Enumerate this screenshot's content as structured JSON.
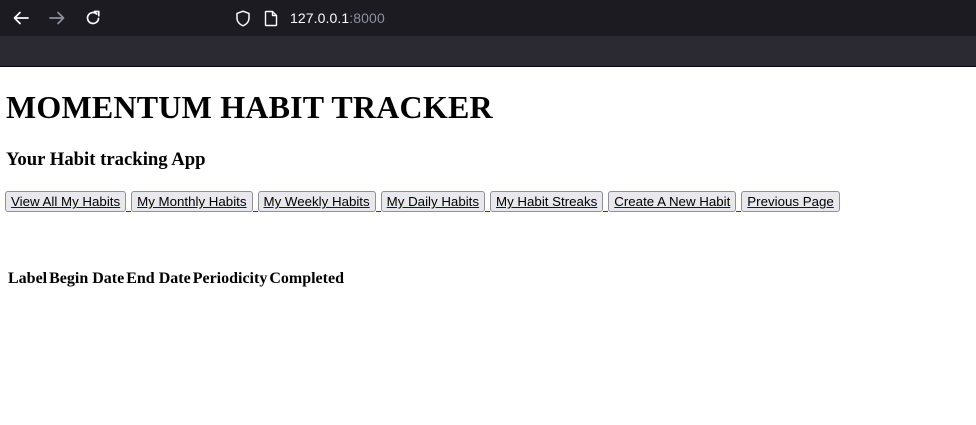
{
  "browser": {
    "url_host": "127.0.0.1",
    "url_port": ":8000",
    "icons": [
      "back-arrow-icon",
      "forward-arrow-icon",
      "reload-icon",
      "shield-icon",
      "page-icon"
    ]
  },
  "page": {
    "title": "MOMENTUM HABIT TRACKER",
    "subtitle": "Your Habit tracking App",
    "nav_buttons": [
      "View All My Habits",
      "My Monthly Habits",
      "My Weekly Habits",
      "My Daily Habits",
      "My Habit Streaks",
      "Create A New Habit",
      "Previous Page"
    ],
    "table": {
      "headers": [
        "Label",
        "Begin Date",
        "End Date",
        "Periodicity",
        "Completed"
      ],
      "rows": []
    }
  }
}
